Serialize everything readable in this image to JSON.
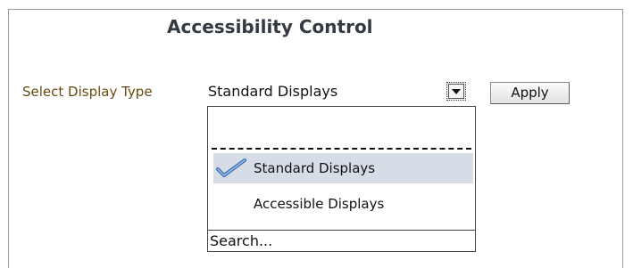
{
  "panel": {
    "title": "Accessibility Control"
  },
  "form": {
    "label": "Select Display Type",
    "selected_value": "Standard Displays",
    "apply_label": "Apply"
  },
  "dropdown": {
    "options": [
      {
        "label": "Standard Displays",
        "selected": true,
        "icon": "checkmark-icon"
      },
      {
        "label": "Accessible Displays",
        "selected": false
      }
    ],
    "search_label": "Search..."
  },
  "colors": {
    "label_text": "#6a4a10",
    "selected_row_bg": "#d7dde6",
    "check_icon": "#3a6fb5"
  }
}
